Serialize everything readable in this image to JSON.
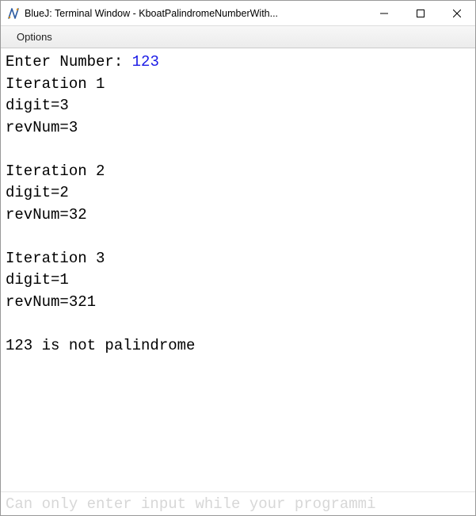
{
  "titlebar": {
    "icon_name": "bluej-icon",
    "title": "BlueJ: Terminal Window - KboatPalindromeNumberWith..."
  },
  "menu": {
    "options_label": "Options"
  },
  "terminal": {
    "prompt": "Enter Number: ",
    "user_input": "123",
    "output_lines": [
      "Iteration 1",
      "digit=3",
      "revNum=3",
      "",
      "Iteration 2",
      "digit=2",
      "revNum=32",
      "",
      "Iteration 3",
      "digit=1",
      "revNum=321",
      "",
      "123 is not palindrome"
    ]
  },
  "status": {
    "text": "Can only enter input while your programmi"
  }
}
